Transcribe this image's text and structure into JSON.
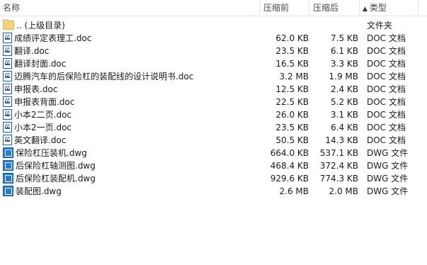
{
  "columns": {
    "name": "名称",
    "size_before": "压缩前",
    "size_after": "压缩后",
    "type": "类型",
    "sort_arrow": "▲"
  },
  "rows": [
    {
      "icon": "folder-icon",
      "name": ".. (上级目录)",
      "size_before": "",
      "size_after": "",
      "type": "文件夹"
    },
    {
      "icon": "word-document-icon",
      "name": "成绩评定表理工.doc",
      "size_before": "62.0 KB",
      "size_after": "7.5 KB",
      "type": "DOC 文档"
    },
    {
      "icon": "word-document-icon",
      "name": "翻译.doc",
      "size_before": "23.5 KB",
      "size_after": "6.1 KB",
      "type": "DOC 文档"
    },
    {
      "icon": "word-document-icon",
      "name": "翻译封面.doc",
      "size_before": "16.5 KB",
      "size_after": "3.3 KB",
      "type": "DOC 文档"
    },
    {
      "icon": "word-document-icon",
      "name": "迈腾汽车的后保险杠的装配线的设计说明书.doc",
      "size_before": "3.2 MB",
      "size_after": "1.9 MB",
      "type": "DOC 文档"
    },
    {
      "icon": "word-document-icon",
      "name": "申报表.doc",
      "size_before": "12.5 KB",
      "size_after": "2.4 KB",
      "type": "DOC 文档"
    },
    {
      "icon": "word-document-icon",
      "name": "申报表背面.doc",
      "size_before": "22.5 KB",
      "size_after": "5.2 KB",
      "type": "DOC 文档"
    },
    {
      "icon": "word-document-icon",
      "name": "小本2二页.doc",
      "size_before": "26.0 KB",
      "size_after": "3.1 KB",
      "type": "DOC 文档"
    },
    {
      "icon": "word-document-icon",
      "name": "小本2一页.doc",
      "size_before": "23.5 KB",
      "size_after": "6.4 KB",
      "type": "DOC 文档"
    },
    {
      "icon": "word-document-icon",
      "name": "英文翻译.doc",
      "size_before": "50.5 KB",
      "size_after": "14.3 KB",
      "type": "DOC 文档"
    },
    {
      "icon": "dwg-drawing-icon",
      "name": "保险杠压装机.dwg",
      "size_before": "664.0 KB",
      "size_after": "537.1 KB",
      "type": "DWG 文件"
    },
    {
      "icon": "dwg-drawing-icon",
      "name": "后保险杠轴测图.dwg",
      "size_before": "468.4 KB",
      "size_after": "372.4 KB",
      "type": "DWG 文件"
    },
    {
      "icon": "dwg-drawing-icon",
      "name": "后保险杠装配机.dwg",
      "size_before": "929.6 KB",
      "size_after": "774.3 KB",
      "type": "DWG 文件"
    },
    {
      "icon": "dwg-drawing-icon",
      "name": "装配图.dwg",
      "size_before": "2.6 MB",
      "size_after": "2.0 MB",
      "type": "DWG 文件"
    }
  ],
  "colors": {
    "folder": "#f6d27a",
    "word": "#2b5797",
    "dwg": "#2a7ec7",
    "header_separator": "#e5e5e5"
  }
}
